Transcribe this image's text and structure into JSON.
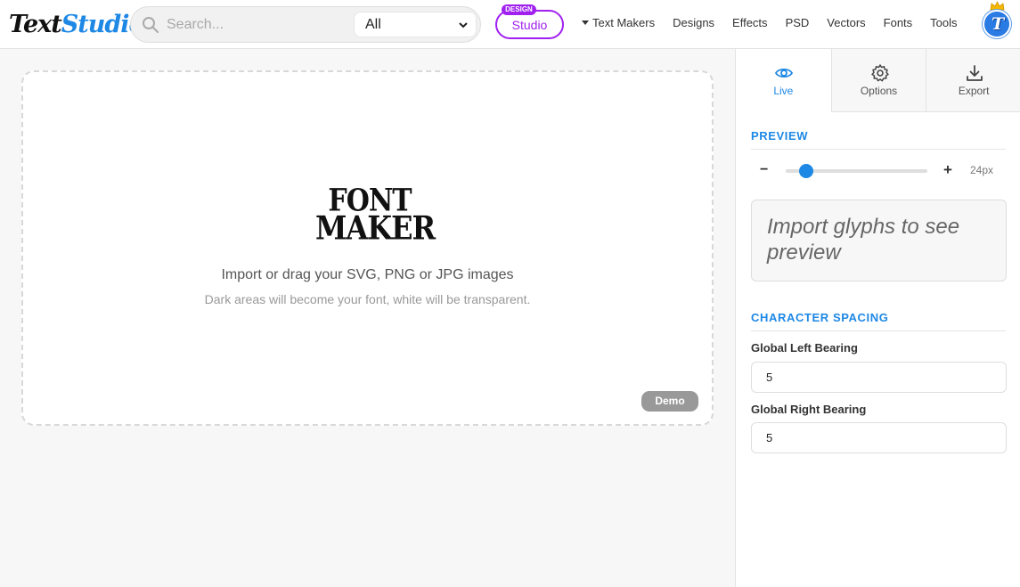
{
  "header": {
    "logo": {
      "part1": "Text",
      "part2": "Studio"
    },
    "search": {
      "placeholder": "Search...",
      "category": "All"
    },
    "studio": {
      "badge": "DESIGN",
      "label": "Studio"
    },
    "nav": [
      "Text Makers",
      "Designs",
      "Effects",
      "PSD",
      "Vectors",
      "Fonts",
      "Tools"
    ],
    "avatar_letter": "T"
  },
  "main": {
    "logo_line1": "FONT",
    "logo_line2": "MAKER",
    "import_text": "Import or drag your SVG, PNG or JPG images",
    "hint_text": "Dark areas will become your font, white will be transparent.",
    "demo_label": "Demo"
  },
  "panel": {
    "tabs": [
      {
        "label": "Live",
        "icon": "eye-icon",
        "active": true
      },
      {
        "label": "Options",
        "icon": "gear-icon",
        "active": false
      },
      {
        "label": "Export",
        "icon": "download-icon",
        "active": false
      }
    ],
    "preview": {
      "title": "PREVIEW",
      "minus": "−",
      "plus": "+",
      "size_value": 24,
      "size_label": "24px",
      "size_min": 12,
      "size_max": 96,
      "placeholder": "Import glyphs to see preview"
    },
    "spacing": {
      "title": "CHARACTER SPACING",
      "left_label": "Global Left Bearing",
      "left_value": "5",
      "right_label": "Global Right Bearing",
      "right_value": "5"
    }
  },
  "colors": {
    "accent": "#1e88e5",
    "studio": "#a020f0",
    "demo": "#999999"
  }
}
